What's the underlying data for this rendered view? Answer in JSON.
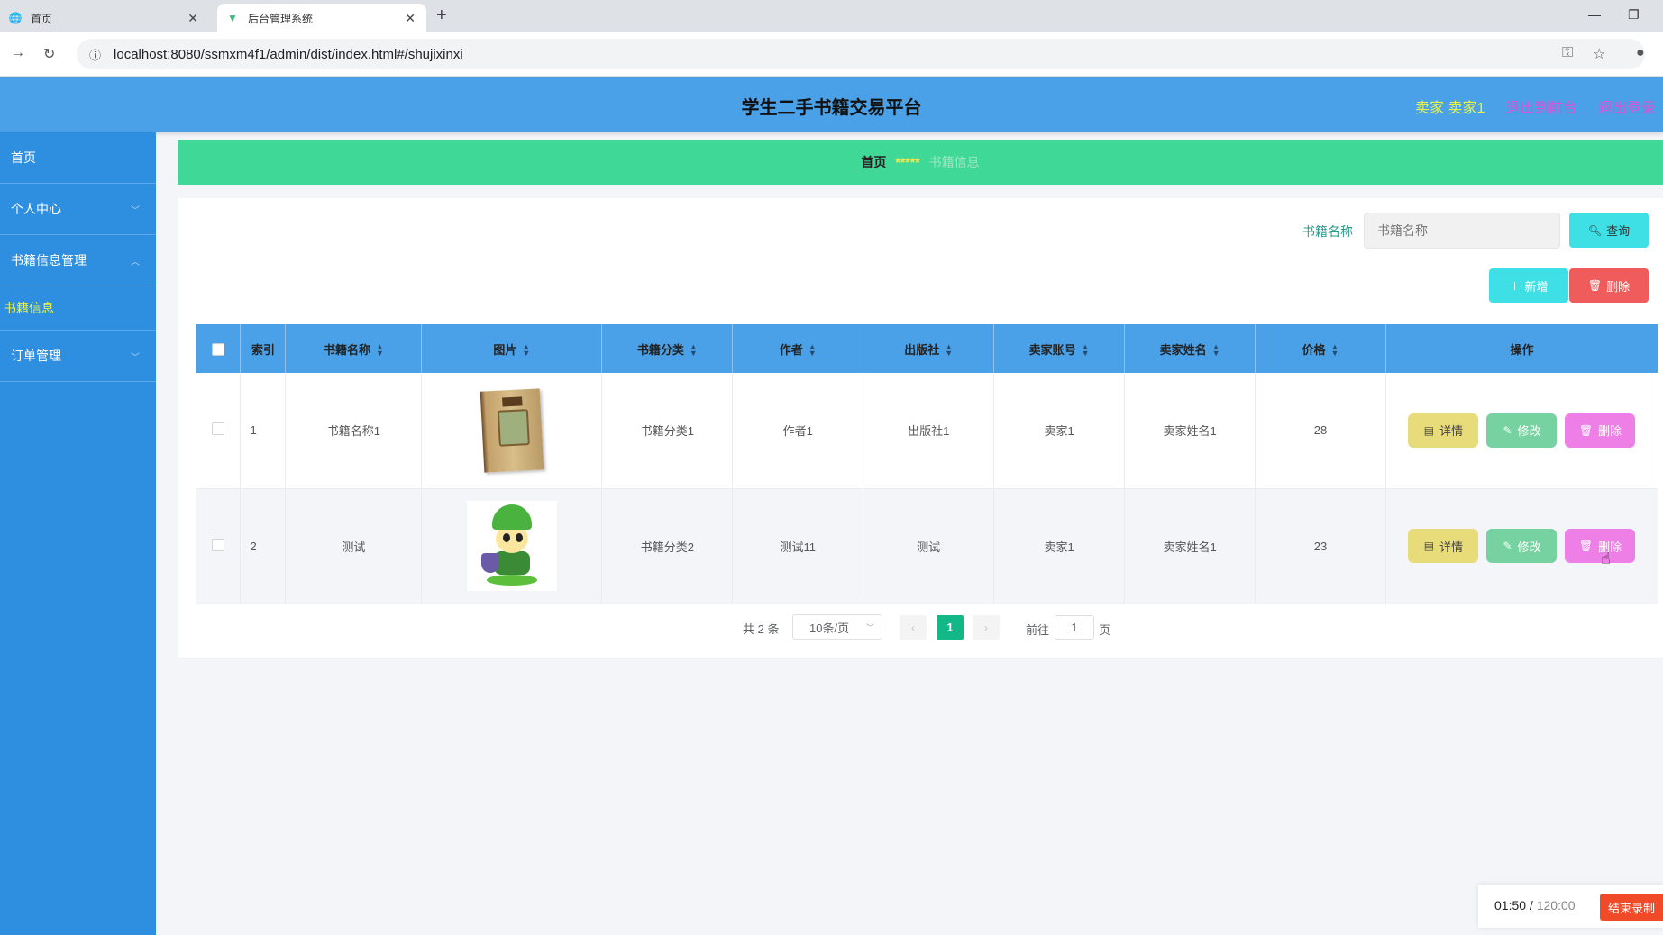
{
  "browser": {
    "tabs": [
      {
        "title": "首页",
        "active": false
      },
      {
        "title": "后台管理系统",
        "active": true
      }
    ],
    "url": "localhost:8080/ssmxm4f1/admin/dist/index.html#/shujixinxi"
  },
  "header": {
    "title": "学生二手书籍交易平台",
    "user_label": "卖家 卖家1",
    "back_front": "退出到前台",
    "logout": "退出登录",
    "colors": {
      "bg": "#4aa1e8",
      "user": "#e8f24a",
      "link": "#e14fd6"
    }
  },
  "sidebar": {
    "items": [
      {
        "label": "首页",
        "has_chevron": false
      },
      {
        "label": "个人中心",
        "has_chevron": true
      },
      {
        "label": "书籍信息管理",
        "has_chevron": true,
        "expanded": true
      },
      {
        "label": "订单管理",
        "has_chevron": true
      }
    ],
    "sub_items": [
      {
        "label": "书籍信息",
        "active": true
      }
    ]
  },
  "breadcrumb": {
    "home": "首页",
    "separator": "*****",
    "current": "书籍信息"
  },
  "search": {
    "label": "书籍名称",
    "placeholder": "书籍名称",
    "button": "查询"
  },
  "actions": {
    "add": "新增",
    "delete": "删除"
  },
  "table": {
    "columns": [
      "索引",
      "书籍名称",
      "图片",
      "书籍分类",
      "作者",
      "出版社",
      "卖家账号",
      "卖家姓名",
      "价格",
      "操作"
    ],
    "rows": [
      {
        "index": "1",
        "name": "书籍名称1",
        "image": "book-cover",
        "category": "书籍分类1",
        "author": "作者1",
        "publisher": "出版社1",
        "seller_account": "卖家1",
        "seller_name": "卖家姓名1",
        "price": "28"
      },
      {
        "index": "2",
        "name": "测试",
        "image": "cartoon-character",
        "category": "书籍分类2",
        "author": "测试11",
        "publisher": "测试",
        "seller_account": "卖家1",
        "seller_name": "卖家姓名1",
        "price": "23"
      }
    ],
    "row_actions": {
      "detail": "详情",
      "edit": "修改",
      "delete": "删除"
    }
  },
  "pagination": {
    "total": "共 2 条",
    "page_size": "10条/页",
    "current": "1",
    "goto_label": "前往",
    "goto_value": "1",
    "unit": "页"
  },
  "recorder": {
    "elapsed": "01:50",
    "limit": "120:00",
    "stop": "结束录制"
  }
}
